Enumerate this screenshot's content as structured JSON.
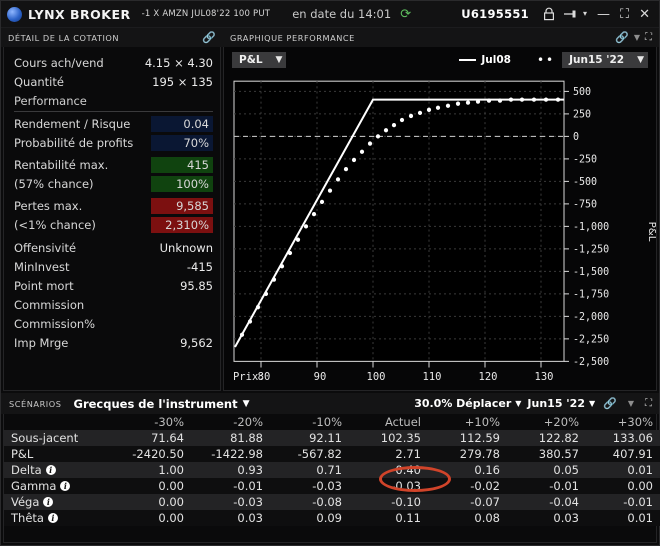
{
  "titlebar": {
    "brand": "LYNX BROKER",
    "contract": "-1 X AMZN JUL08'22 100 PUT",
    "asof": "en date du 14:01",
    "refresh_icon": "refresh-icon",
    "account": "U6195551",
    "lock_icon": "lock-icon",
    "pin_icon": "pin-icon",
    "pin_caret": "▾",
    "minimize": "—",
    "maximize": "⛶",
    "close": "✕"
  },
  "quote_panel": {
    "title": "DÉTAIL DE LA COTATION",
    "link_icon": "link-icon",
    "rows": [
      {
        "label": "Cours ach/vend",
        "value": "4.15 × 4.30"
      },
      {
        "label": "Quantité",
        "value": "195 × 135"
      }
    ],
    "section_performance": "Performance",
    "metrics": [
      {
        "label": "Rendement / Risque",
        "value": "0.04",
        "bg": "navy"
      },
      {
        "label": "Probabilité de profits",
        "value": "70%",
        "bg": "navy"
      }
    ],
    "max_profit": {
      "label": "Rentabilité max.",
      "value": "415",
      "sub_label": "(57% chance)",
      "sub_value": "100%",
      "bg": "green"
    },
    "max_loss": {
      "label": "Pertes max.",
      "value": "9,585",
      "sub_label": "(<1% chance)",
      "sub_value": "2,310%",
      "bg": "red"
    },
    "tail_rows": [
      {
        "label": "Offensivité",
        "value": "Unknown"
      },
      {
        "label": "MinInvest",
        "value": "-415"
      },
      {
        "label": "Point mort",
        "value": "95.85"
      },
      {
        "label": "Commission",
        "value": ""
      },
      {
        "label": "Commission%",
        "value": ""
      },
      {
        "label": "Imp Mrge",
        "value": "9,562"
      }
    ]
  },
  "chart_panel": {
    "title": "GRAPHIQUE PERFORMANCE",
    "link_icon": "link-icon",
    "caret_icon": "chevron-down-icon",
    "expand_icon": "expand-icon",
    "metric_dropdown": "P&L",
    "dd_caret": "▼",
    "legend": [
      {
        "style": "line",
        "label": "Jul08"
      },
      {
        "style": "dots",
        "label": "Jun15 '22"
      }
    ],
    "date_dropdown": "Jun15 '22"
  },
  "chart_data": {
    "type": "line",
    "title": "P&L",
    "xlabel": "Prix:",
    "ylabel": "P&L",
    "xlim": [
      75,
      134
    ],
    "ylim": [
      -2600,
      620
    ],
    "xticks": [
      80,
      90,
      100,
      110,
      120,
      130
    ],
    "yticks": [
      500,
      250,
      0,
      -250,
      -500,
      -750,
      -1000,
      -1250,
      -1500,
      -1750,
      -2000,
      -2250,
      -2500
    ],
    "grid": true,
    "zero_line": 0,
    "legend_position": "top-right",
    "series": [
      {
        "name": "Jul08",
        "style": "solid",
        "x": [
          75.5,
          100,
          134
        ],
        "y": [
          -2460,
          415,
          415
        ]
      },
      {
        "name": "Jun15 '22",
        "style": "dotted",
        "x": [
          77,
          80,
          83,
          86,
          89,
          92,
          95,
          98,
          101,
          104,
          107,
          110,
          113,
          116,
          119,
          122,
          125,
          128,
          131,
          134
        ],
        "y": [
          -2320,
          -2010,
          -1700,
          -1395,
          -1095,
          -810,
          -545,
          -315,
          -125,
          20,
          135,
          218,
          280,
          322,
          352,
          374,
          389,
          399,
          406,
          411
        ]
      }
    ]
  },
  "scenarios_panel": {
    "tag": "SCÉNARIOS",
    "title": "Grecques de l'instrument",
    "dd_caret": "▼",
    "move_control": "30.0% Déplacer",
    "date_control": "Jun15 '22",
    "link_icon": "link-icon",
    "caret_icon": "chevron-down-icon",
    "expand_icon": "expand-icon",
    "columns": [
      "",
      "-30%",
      "-20%",
      "-10%",
      "Actuel",
      "+10%",
      "+20%",
      "+30%"
    ],
    "rows": [
      {
        "label": "Sous-jacent",
        "info": false,
        "values": [
          "71.64",
          "81.88",
          "92.11",
          "102.35",
          "112.59",
          "122.82",
          "133.06"
        ]
      },
      {
        "label": "P&L",
        "info": false,
        "values": [
          "-2420.50",
          "-1422.98",
          "-567.82",
          "2.71",
          "279.78",
          "380.57",
          "407.91"
        ]
      },
      {
        "label": "Delta",
        "info": true,
        "values": [
          "1.00",
          "0.93",
          "0.71",
          "0.40",
          "0.16",
          "0.05",
          "0.01"
        ]
      },
      {
        "label": "Gamma",
        "info": true,
        "values": [
          "0.00",
          "-0.01",
          "-0.03",
          "-0.03",
          "-0.02",
          "-0.01",
          "0.00"
        ]
      },
      {
        "label": "Véga",
        "info": true,
        "values": [
          "0.00",
          "-0.03",
          "-0.08",
          "-0.10",
          "-0.07",
          "-0.04",
          "-0.01"
        ]
      },
      {
        "label": "Thêta",
        "info": true,
        "values": [
          "0.00",
          "0.03",
          "0.09",
          "0.11",
          "0.08",
          "0.03",
          "0.01"
        ]
      }
    ],
    "annotation": {
      "type": "ellipse-highlight",
      "target": "delta-actuel",
      "color": "#d1442a"
    }
  }
}
